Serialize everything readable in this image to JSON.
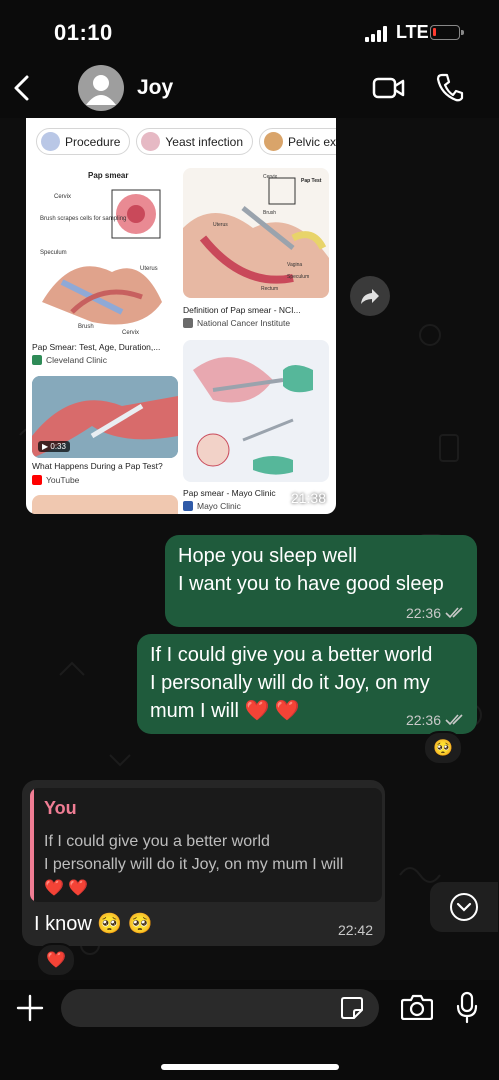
{
  "status_bar": {
    "time": "01:10",
    "network": "LTE"
  },
  "header": {
    "contact_name": "Joy"
  },
  "image_message": {
    "chips": [
      "Procedure",
      "Yeast infection",
      "Pelvic exam"
    ],
    "results": [
      {
        "title": "Pap smear",
        "labels": [
          "Cervix",
          "Brush scrapes cells for sampling",
          "Speculum",
          "Uterus",
          "Brush",
          "Cervix"
        ],
        "caption": "Pap Smear: Test, Age, Duration,...",
        "source": "Cleveland Clinic"
      },
      {
        "title": "Pap Test",
        "labels": [
          "Cervix",
          "Brush",
          "Uterus",
          "Vagina",
          "Rectum",
          "Speculum"
        ],
        "caption": "Definition of Pap smear - NCI...",
        "source": "National Cancer Institute"
      },
      {
        "duration": "0:33",
        "caption": "What Happens During a Pap Test?",
        "source": "YouTube"
      },
      {
        "caption": "Pap smear - Mayo Clinic",
        "source": "Mayo Clinic"
      }
    ],
    "time": "21:38"
  },
  "messages": [
    {
      "lines": [
        "Hope you sleep well",
        "I want you to have good sleep"
      ],
      "time": "22:36"
    },
    {
      "lines": [
        "If I could give you a better world",
        "I personally will do it Joy, on my",
        "mum I will ❤️ ❤️"
      ],
      "time": "22:36",
      "reaction": "🥺"
    },
    {
      "quote": {
        "author": "You",
        "lines": [
          "If I could give you a better world",
          "I personally will do it Joy, on my mum I will",
          "❤️ ❤️"
        ]
      },
      "text": "I know 🥺 🥺",
      "time": "22:42",
      "reaction": "❤️"
    }
  ],
  "composer": {
    "placeholder": ""
  },
  "colors": {
    "outgoing_bubble": "#1f5b3c",
    "incoming_bubble": "#262626",
    "quote_accent": "#f07d94",
    "battery_low": "#ff3b30"
  },
  "icons": [
    "back-icon",
    "avatar-icon",
    "video-call-icon",
    "phone-icon",
    "forward-icon",
    "double-check-icon",
    "chevron-down-icon",
    "plus-icon",
    "sticker-icon",
    "camera-icon",
    "microphone-icon"
  ],
  "battery_level": 0.15
}
